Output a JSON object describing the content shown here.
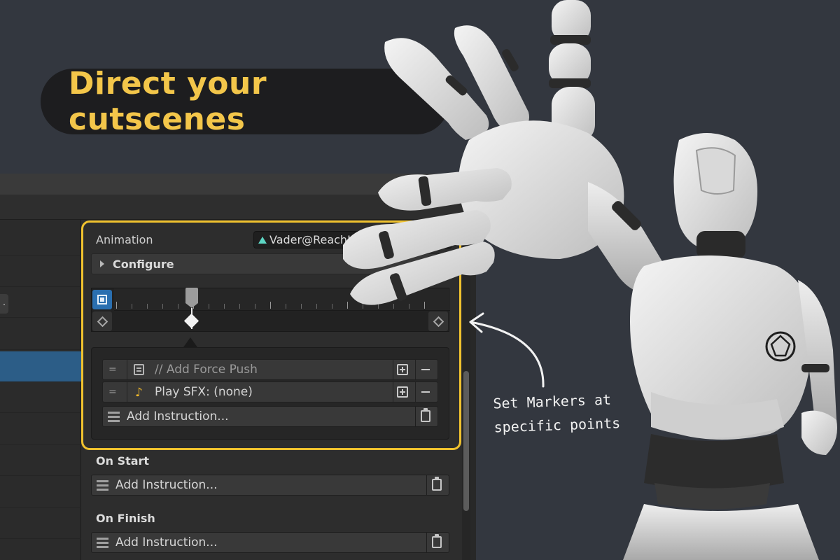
{
  "headline": "Direct your cutscenes",
  "inspector": {
    "animation_label": "Animation",
    "animation_value": "Vader@ReachH",
    "configure_label": "Configure",
    "instructions": [
      {
        "text": "// Add Force Push",
        "icon": "note-icon",
        "is_comment": true
      },
      {
        "text": "Play SFX: (none)",
        "icon": "music-note-icon",
        "is_comment": false
      }
    ],
    "add_instruction_label": "Add Instruction...",
    "on_start_label": "On Start",
    "on_start_add_label": "Add Instruction...",
    "on_finish_label": "On Finish",
    "on_finish_add_label": "Add Instruction..."
  },
  "annotation": {
    "line1": "Set Markers at",
    "line2": "specific points"
  },
  "colors": {
    "background": "#33373f",
    "headline_text": "#f3c64a",
    "highlight_border": "#f0c22e",
    "selection_blue": "#2c5d87"
  }
}
